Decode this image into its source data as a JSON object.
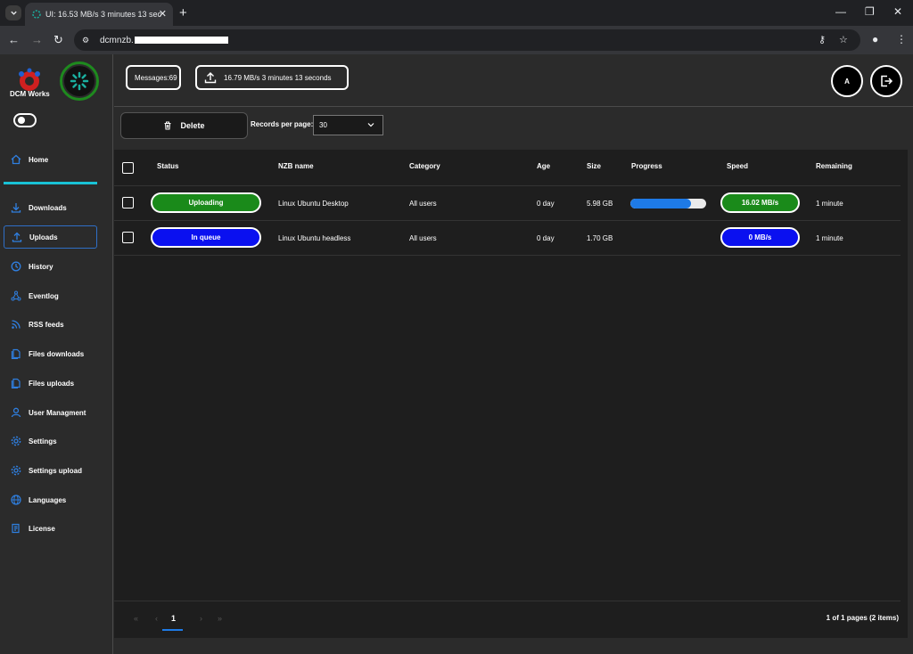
{
  "browser": {
    "tab_title": "UI: 16.53 MB/s 3 minutes 13 sec",
    "url_visible": "dcmnzb."
  },
  "sidebar": {
    "logo_text": "DCM Works",
    "items": [
      {
        "label": "Home",
        "icon": "home-icon"
      },
      {
        "label": "Downloads",
        "icon": "download-icon"
      },
      {
        "label": "Uploads",
        "icon": "upload-icon"
      },
      {
        "label": "History",
        "icon": "history-icon"
      },
      {
        "label": "Eventlog",
        "icon": "network-icon"
      },
      {
        "label": "RSS feeds",
        "icon": "rss-icon"
      },
      {
        "label": "Files downloads",
        "icon": "files-icon"
      },
      {
        "label": "Files uploads",
        "icon": "files-icon"
      },
      {
        "label": "User Managment",
        "icon": "user-icon"
      },
      {
        "label": "Settings",
        "icon": "gear-icon"
      },
      {
        "label": "Settings upload",
        "icon": "gear-icon"
      },
      {
        "label": "Languages",
        "icon": "globe-icon"
      },
      {
        "label": "License",
        "icon": "license-icon"
      }
    ],
    "active_item": "Uploads"
  },
  "header": {
    "messages": "Messages:69",
    "speed": "16.79 MB/s",
    "time": "3 minutes 13 seconds",
    "avatar_letter": "A"
  },
  "toolbar": {
    "delete_label": "Delete",
    "records_label": "Records per page:",
    "records_value": "30"
  },
  "table": {
    "headers": {
      "status": "Status",
      "name": "NZB name",
      "category": "Category",
      "age": "Age",
      "size": "Size",
      "progress": "Progress",
      "speed": "Speed",
      "remaining": "Remaining"
    },
    "rows": [
      {
        "status": "Uploading",
        "status_color": "#1a8a1a",
        "name": "Linux Ubuntu Desktop",
        "category": "All users",
        "age": "0 day",
        "size": "5.98 GB",
        "progress": 0.8,
        "speed": "16.02 MB/s",
        "speed_color": "#1a8a1a",
        "remaining": "1 minute"
      },
      {
        "status": "In queue",
        "status_color": "#0a10f0",
        "name": "Linux Ubuntu headless",
        "category": "All users",
        "age": "0 day",
        "size": "1.70 GB",
        "progress": null,
        "speed": "0 MB/s",
        "speed_color": "#0a10f0",
        "remaining": "1 minute"
      }
    ]
  },
  "pagination": {
    "current_page": "1",
    "info": "1 of 1 pages (2 items)"
  }
}
